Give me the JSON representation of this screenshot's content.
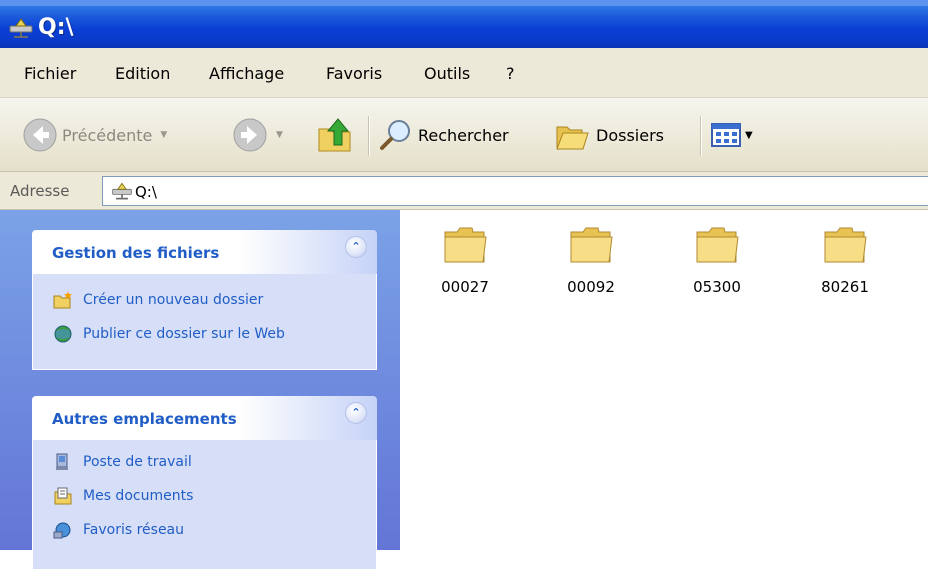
{
  "window": {
    "title": "Q:\\"
  },
  "menu": [
    "Fichier",
    "Edition",
    "Affichage",
    "Favoris",
    "Outils",
    "?"
  ],
  "toolbar": {
    "back_label": "Précédente",
    "search_label": "Rechercher",
    "folders_label": "Dossiers"
  },
  "address": {
    "label": "Adresse",
    "value": "Q:\\"
  },
  "panels": {
    "file_tasks": {
      "title": "Gestion des fichiers",
      "items": [
        "Créer un nouveau dossier",
        "Publier ce dossier sur le Web"
      ]
    },
    "other_places": {
      "title": "Autres emplacements",
      "items": [
        "Poste de travail",
        "Mes documents",
        "Favoris réseau"
      ]
    }
  },
  "folders": [
    "00027",
    "00092",
    "05300",
    "80261"
  ],
  "colors": {
    "title_bar": "#0a3fd4",
    "task_pane": "#7ba2e7",
    "link_blue": "#215dc6",
    "chrome": "#ece9d8"
  }
}
